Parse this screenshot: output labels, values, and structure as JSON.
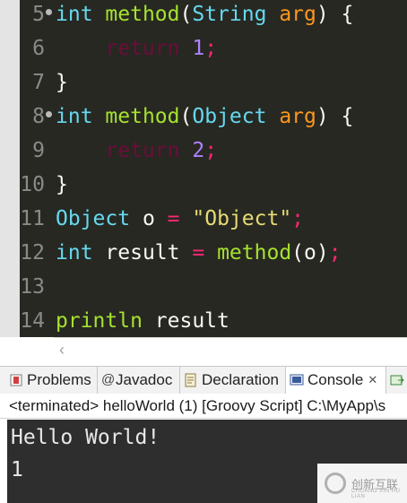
{
  "editor": {
    "lines": [
      {
        "n": "5",
        "text": "int method(String arg) {"
      },
      {
        "n": "6",
        "text": "    return 1;"
      },
      {
        "n": "7",
        "text": "}"
      },
      {
        "n": "8",
        "text": "int method(Object arg) {"
      },
      {
        "n": "9",
        "text": "    return 2;"
      },
      {
        "n": "10",
        "text": "}"
      },
      {
        "n": "11",
        "text": "Object o = \"Object\";"
      },
      {
        "n": "12",
        "text": "int result = method(o);"
      },
      {
        "n": "13",
        "text": ""
      },
      {
        "n": "14",
        "text": "println result"
      }
    ],
    "tokens": {
      "int": "int",
      "method": "method",
      "string": "String",
      "object": "Object",
      "arg": "arg",
      "return": "return",
      "one": "1",
      "two": "2",
      "o": "o",
      "eq": "=",
      "str_object": "\"Object\"",
      "result": "result",
      "println": "println",
      "lparen": "(",
      "rparen_brace": ") {",
      "rbrace": "}",
      "semi": ";"
    },
    "scroll_arrow": "‹",
    "colors": {
      "background": "#272822",
      "keyword": "#66d9ef",
      "function": "#a6e22e",
      "number": "#ae81ff",
      "string": "#e6db74",
      "operator": "#f92672",
      "param": "#fd971f"
    }
  },
  "tabs": [
    {
      "label": "Problems",
      "icon": "problems-icon"
    },
    {
      "label": "Javadoc",
      "icon": "at-icon"
    },
    {
      "label": "Declaration",
      "icon": "declaration-icon"
    },
    {
      "label": "Console",
      "icon": "console-icon",
      "active": true
    }
  ],
  "status_line": "<terminated> helloWorld (1) [Groovy Script] C:\\MyApp\\s",
  "console_output": [
    "Hello World!",
    "1"
  ],
  "watermark": {
    "text": "创新互联",
    "sub": "CHUANG XIN HU LIAN"
  }
}
